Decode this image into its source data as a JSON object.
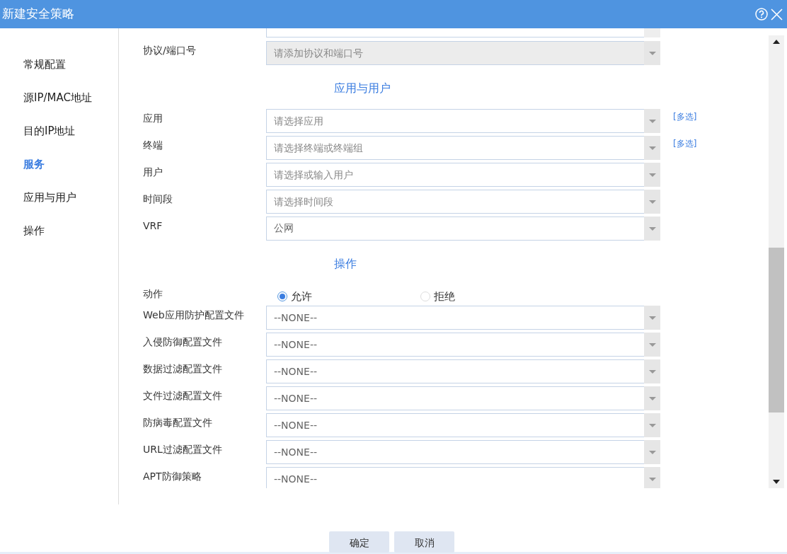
{
  "window": {
    "title": "新建安全策略"
  },
  "sidebar": [
    {
      "label": "常规配置",
      "selected": false
    },
    {
      "label": "源IP/MAC地址",
      "selected": false
    },
    {
      "label": "目的IP地址",
      "selected": false
    },
    {
      "label": "服务",
      "selected": true
    },
    {
      "label": "应用与用户",
      "selected": false
    },
    {
      "label": "操作",
      "selected": false
    }
  ],
  "form": [
    {
      "kind": "select",
      "label": "协议/端口号",
      "placeholder": "请添加协议和端口号",
      "disabled": true
    },
    {
      "kind": "heading",
      "text": "应用与用户"
    },
    {
      "kind": "select",
      "label": "应用",
      "placeholder": "请选择应用",
      "link": "[多选]",
      "disabled": false
    },
    {
      "kind": "select",
      "label": "终端",
      "placeholder": "请选择终端或终端组",
      "link": "[多选]",
      "disabled": false
    },
    {
      "kind": "select",
      "label": "用户",
      "placeholder": "请选择或输入用户",
      "disabled": false
    },
    {
      "kind": "select",
      "label": "时间段",
      "placeholder": "请选择时间段",
      "disabled": false
    },
    {
      "kind": "select",
      "label": "VRF",
      "value": "公网",
      "disabled": false
    },
    {
      "kind": "heading",
      "text": "操作"
    },
    {
      "kind": "radio",
      "label": "动作",
      "options": [
        {
          "label": "允许",
          "selected": true
        },
        {
          "label": "拒绝",
          "selected": false
        }
      ]
    },
    {
      "kind": "select",
      "label": "Web应用防护配置文件",
      "value": "--NONE--",
      "disabled": false
    },
    {
      "kind": "select",
      "label": "入侵防御配置文件",
      "value": "--NONE--",
      "disabled": false
    },
    {
      "kind": "select",
      "label": "数据过滤配置文件",
      "value": "--NONE--",
      "disabled": false
    },
    {
      "kind": "select",
      "label": "文件过滤配置文件",
      "value": "--NONE--",
      "disabled": false
    },
    {
      "kind": "select",
      "label": "防病毒配置文件",
      "value": "--NONE--",
      "disabled": false
    },
    {
      "kind": "select",
      "label": "URL过滤配置文件",
      "value": "--NONE--",
      "disabled": false
    },
    {
      "kind": "select",
      "label": "APT防御策略",
      "value": "--NONE--",
      "disabled": false
    }
  ],
  "buttons": [
    "确定",
    "取消"
  ]
}
